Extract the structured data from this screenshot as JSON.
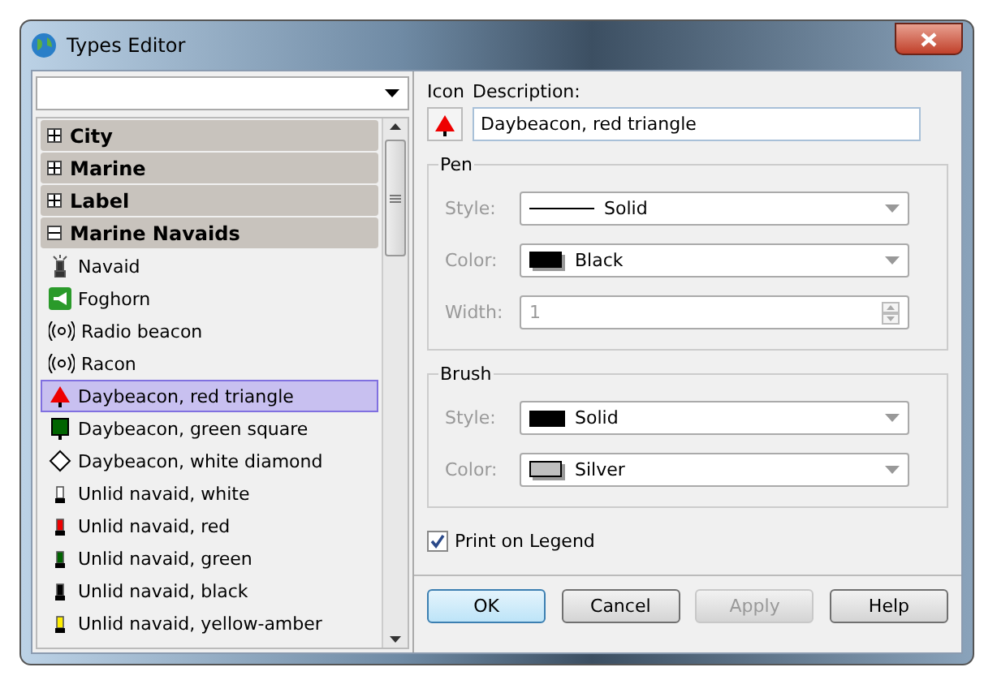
{
  "window": {
    "title": "Types Editor"
  },
  "groups": [
    {
      "label": "City",
      "expanded": false
    },
    {
      "label": "Marine",
      "expanded": false
    },
    {
      "label": "Label",
      "expanded": false
    },
    {
      "label": "Marine Navaids",
      "expanded": true,
      "children": [
        {
          "label": "Navaid",
          "kind": "navaid",
          "selected": false
        },
        {
          "label": "Foghorn",
          "kind": "foghorn",
          "selected": false
        },
        {
          "label": "Radio beacon",
          "kind": "radio",
          "selected": false
        },
        {
          "label": "Racon",
          "kind": "radio",
          "selected": false
        },
        {
          "label": "Daybeacon, red triangle",
          "kind": "triangle",
          "color": "#ee0000",
          "selected": true
        },
        {
          "label": "Daybeacon, green square",
          "kind": "square",
          "color": "#006400",
          "selected": false
        },
        {
          "label": "Daybeacon, white diamond",
          "kind": "diamond",
          "color": "#ffffff",
          "selected": false
        },
        {
          "label": "Unlid navaid, white",
          "kind": "unlit",
          "color": "#ffffff",
          "selected": false
        },
        {
          "label": "Unlid navaid, red",
          "kind": "unlit",
          "color": "#ee0000",
          "selected": false
        },
        {
          "label": "Unlid navaid, green",
          "kind": "unlit",
          "color": "#006400",
          "selected": false
        },
        {
          "label": "Unlid navaid, black",
          "kind": "unlit",
          "color": "#000000",
          "selected": false
        },
        {
          "label": "Unlid navaid, yellow-amber",
          "kind": "unlit",
          "color": "#ffee00",
          "selected": false
        }
      ]
    }
  ],
  "icon_label": "Icon",
  "description": {
    "label": "Description:",
    "value": "Daybeacon, red triangle"
  },
  "pen": {
    "title": "Pen",
    "fields": [
      {
        "label": "Style:",
        "kind": "line",
        "value": "Solid"
      },
      {
        "label": "Color:",
        "kind": "swatch",
        "color": "#000000",
        "value": "Black"
      },
      {
        "label": "Width:",
        "kind": "number",
        "value": "1",
        "disabled": true
      }
    ]
  },
  "brush": {
    "title": "Brush",
    "fields": [
      {
        "label": "Style:",
        "kind": "fill",
        "color": "#000000",
        "value": "Solid"
      },
      {
        "label": "Color:",
        "kind": "swatch",
        "color": "#c0c0c0",
        "value": "Silver"
      }
    ]
  },
  "print_on_legend": {
    "label": "Print on Legend",
    "checked": true
  },
  "buttons": [
    {
      "label": "OK",
      "default": true,
      "disabled": false
    },
    {
      "label": "Cancel",
      "default": false,
      "disabled": false
    },
    {
      "label": "Apply",
      "default": false,
      "disabled": true
    },
    {
      "label": "Help",
      "default": false,
      "disabled": false
    }
  ]
}
